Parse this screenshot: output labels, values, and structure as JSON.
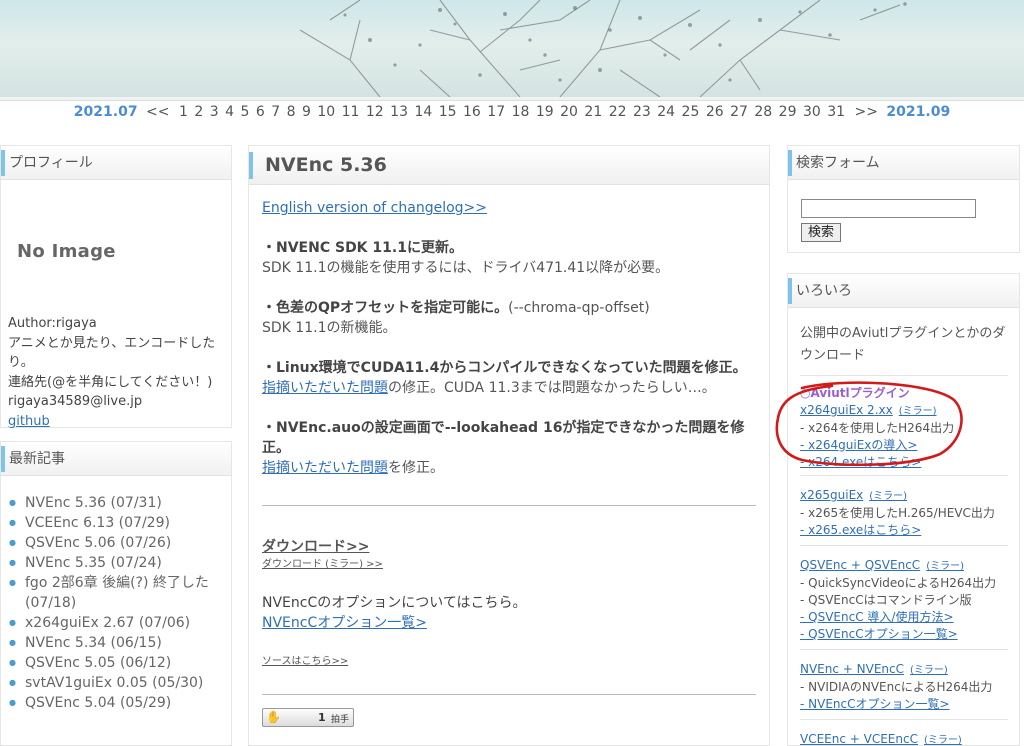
{
  "calendar": {
    "prev_month": "2021.07",
    "prev_arrow": "<<",
    "days": [
      "1",
      "2",
      "3",
      "4",
      "5",
      "6",
      "7",
      "8",
      "9",
      "10",
      "11",
      "12",
      "13",
      "14",
      "15",
      "16",
      "17",
      "18",
      "19",
      "20",
      "21",
      "22",
      "23",
      "24",
      "25",
      "26",
      "27",
      "28",
      "29",
      "30",
      "31"
    ],
    "next_arrow": ">>",
    "next_month": "2021.09"
  },
  "profile": {
    "title": "プロフィール",
    "no_image": "No Image",
    "lines": [
      "Author:rigaya",
      "アニメとか見たり、エンコードしたり。",
      "連絡先(@を半角にしてください！)",
      "rigaya34589@live.jp"
    ],
    "github": "github"
  },
  "recent": {
    "title": "最新記事",
    "items": [
      "NVEnc 5.36 (07/31)",
      "VCEEnc 6.13 (07/29)",
      "QSVEnc 5.06 (07/26)",
      "NVEnc 5.35 (07/24)",
      "fgo 2部6章 後編(?) 終了した (07/18)",
      "x264guiEx 2.67 (07/06)",
      "NVEnc 5.34 (06/15)",
      "QSVEnc 5.05 (06/12)",
      "svtAV1guiEx 0.05 (05/30)",
      "QSVEnc 5.04 (05/29)"
    ]
  },
  "post": {
    "title": "NVEnc 5.36",
    "english_link": "English version of changelog>>",
    "item1_bold": "・NVENC SDK 11.1に更新。",
    "item1_text": "SDK 11.1の機能を使用するには、ドライバ471.41以降が必要。",
    "item2_bold": "・色差のQPオフセットを指定可能に。",
    "item2_opt": "(--chroma-qp-offset)",
    "item2_text": "SDK 11.1の新機能。",
    "item3_bold": "・Linux環境でCUDA11.4からコンパイルできなくなっていた問題を修正。",
    "item3_link": "指摘いただいた問題",
    "item3_text": "の修正。CUDA 11.3までは問題なかったらしい…。",
    "item4_bold": "・NVEnc.auoの設定画面で--lookahead 16が指定できなかった問題を修正。",
    "item4_link": "指摘いただいた問題",
    "item4_text": "を修正。",
    "download_title": "ダウンロード>>",
    "download_sub": "ダウンロード (ミラー) >>",
    "options_text": "NVEncCのオプションについてはこちら。",
    "options_link": "NVEncCオプション一覧>",
    "source_link": "ソースはこちら>>",
    "clap_count": "1",
    "clap_label": "拍手"
  },
  "search": {
    "title": "検索フォーム",
    "value": "",
    "button": "検索"
  },
  "misc": {
    "title": "いろいろ",
    "intro": "公開中のAviutlプラグインとかのダウンロード",
    "category": "○Aviutlプラグイン",
    "x264": {
      "name": "x264guiEx 2.xx",
      "mirror": "(ミラー)",
      "desc": "- x264を使用したH264出力",
      "link1": "- x264guiExの導入>",
      "link2": "- x264.exeはこちら>"
    },
    "x265": {
      "name": "x265guiEx",
      "mirror": "(ミラー)",
      "desc": "- x265を使用したH.265/HEVC出力",
      "link1": "- x265.exeはこちら>"
    },
    "qsv": {
      "name": "QSVEnc + QSVEncC",
      "mirror": "(ミラー)",
      "desc1": "- QuickSyncVideoによるH264出力",
      "desc2": "- QSVEncCはコマンドライン版",
      "link1": "- QSVEncC 導入/使用方法>",
      "link2": "- QSVEncCオプション一覧>"
    },
    "nvenc": {
      "name": "NVEnc + NVEncC",
      "mirror": "(ミラー)",
      "desc": "- NVIDIAのNVEncによるH264出力",
      "link1": "- NVEncCオプション一覧>"
    },
    "vce": {
      "name": "VCEEnc + VCEEncC",
      "mirror": "(ミラー)"
    }
  },
  "colors": {
    "accent": "#7fc3ea",
    "link": "#2f6fb7",
    "month": "#4a8dd6",
    "annotation": "#d11a1a"
  }
}
